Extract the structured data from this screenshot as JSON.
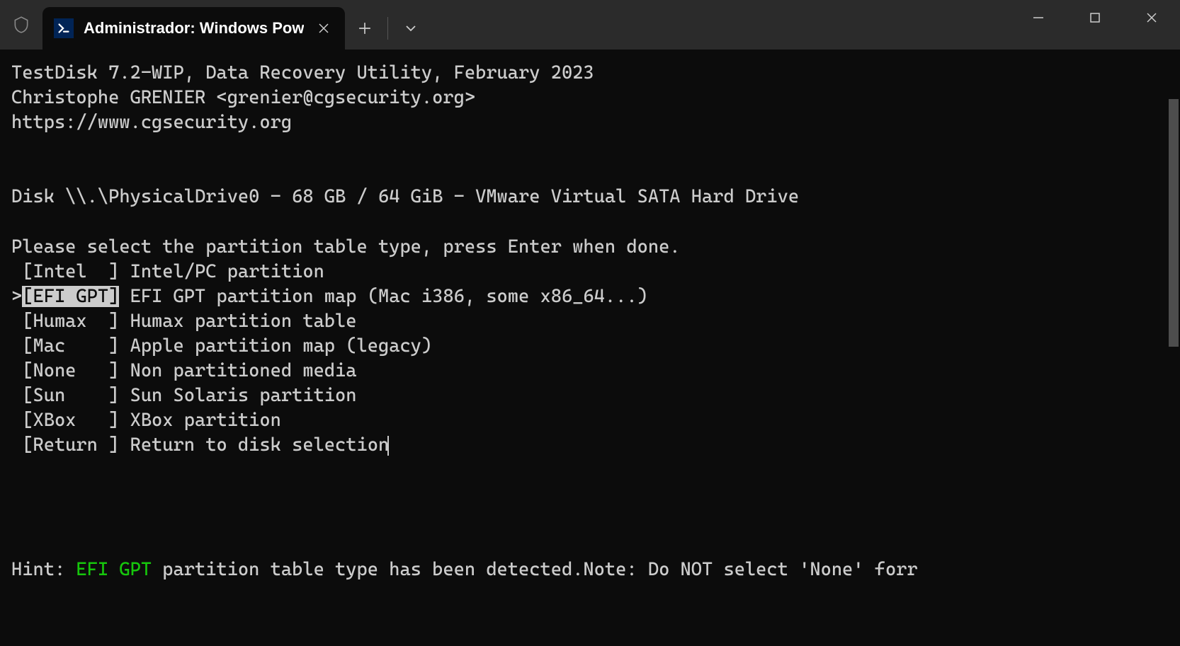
{
  "titlebar": {
    "tab_title": "Administrador: Windows Pow"
  },
  "terminal": {
    "header_line1": "TestDisk 7.2-WIP, Data Recovery Utility, February 2023",
    "header_line2": "Christophe GRENIER <grenier@cgsecurity.org>",
    "header_line3": "https://www.cgsecurity.org",
    "disk_info": "Disk \\\\.\\PhysicalDrive0 - 68 GB / 64 GiB - VMware Virtual SATA Hard Drive",
    "prompt": "Please select the partition table type, press Enter when done.",
    "menu": [
      {
        "prefix": " ",
        "label": "[Intel  ]",
        "desc": " Intel/PC partition",
        "selected": false
      },
      {
        "prefix": ">",
        "label": "[EFI GPT]",
        "desc": " EFI GPT partition map (Mac i386, some x86_64...)",
        "selected": true
      },
      {
        "prefix": " ",
        "label": "[Humax  ]",
        "desc": " Humax partition table",
        "selected": false
      },
      {
        "prefix": " ",
        "label": "[Mac    ]",
        "desc": " Apple partition map (legacy)",
        "selected": false
      },
      {
        "prefix": " ",
        "label": "[None   ]",
        "desc": " Non partitioned media",
        "selected": false
      },
      {
        "prefix": " ",
        "label": "[Sun    ]",
        "desc": " Sun Solaris partition",
        "selected": false
      },
      {
        "prefix": " ",
        "label": "[XBox   ]",
        "desc": " XBox partition",
        "selected": false
      },
      {
        "prefix": " ",
        "label": "[Return ]",
        "desc": " Return to disk selection",
        "selected": false
      }
    ],
    "hint_label": "Hint: ",
    "hint_detected": "EFI GPT",
    "hint_rest": " partition table type has been detected.Note: Do NOT select 'None' forr"
  }
}
